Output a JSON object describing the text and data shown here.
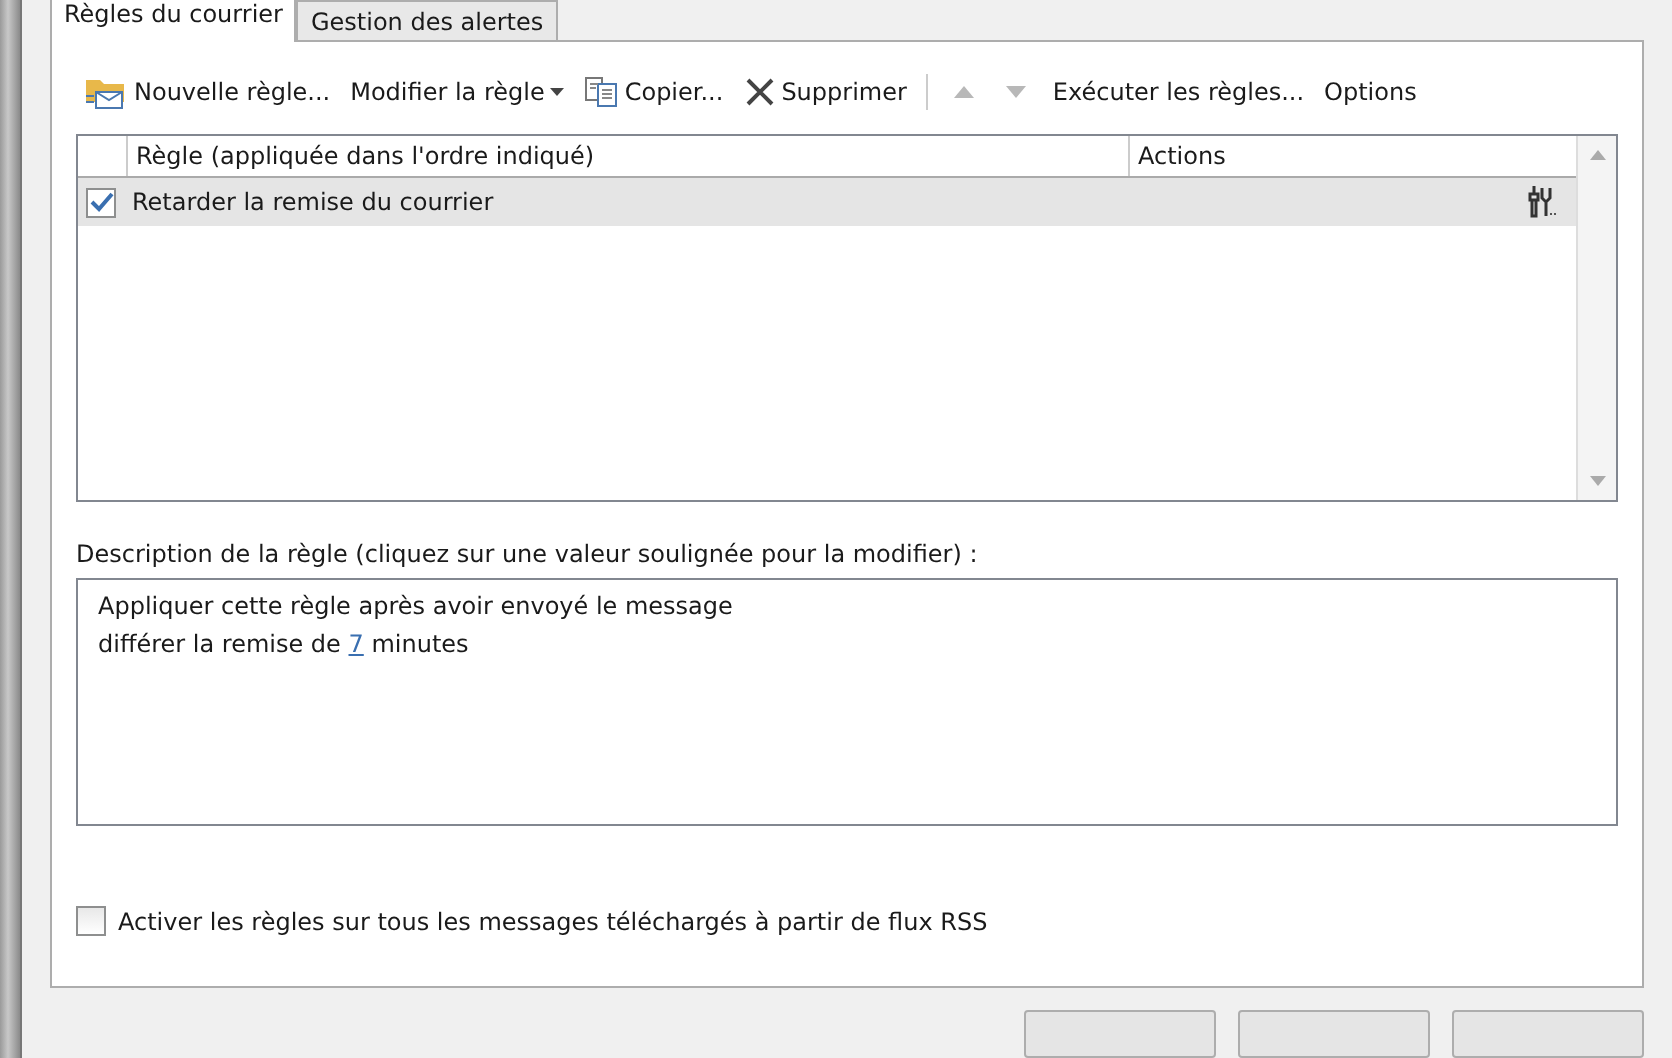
{
  "tabs": [
    {
      "label": "Règles du courrier",
      "selected": true
    },
    {
      "label": "Gestion des alertes",
      "selected": false
    }
  ],
  "toolbar": [
    {
      "kind": "new",
      "label": "Nouvelle règle...",
      "disabled": false
    },
    {
      "kind": "menu",
      "label": "Modifier la règle",
      "disabled": false
    },
    {
      "kind": "copy",
      "label": "Copier...",
      "disabled": false
    },
    {
      "kind": "delete",
      "label": "Supprimer",
      "disabled": false
    },
    {
      "kind": "up",
      "disabled": true
    },
    {
      "kind": "down",
      "disabled": true
    },
    {
      "kind": "text",
      "label": "Exécuter les règles...",
      "disabled": false
    },
    {
      "kind": "text",
      "label": "Options",
      "disabled": false
    }
  ],
  "rules_table": {
    "columns": [
      "Règle (appliquée dans l'ordre indiqué)",
      "Actions"
    ],
    "rows": [
      {
        "name": "Retarder la remise du courrier",
        "checked": true,
        "selected": true
      }
    ]
  },
  "description": {
    "label": "Description de la règle (cliquez sur une valeur soulignée pour la modifier) :",
    "lines": [
      {
        "before": "Appliquer cette règle après avoir envoyé le message"
      },
      {
        "before": "différer la remise de ",
        "link": "7",
        "after": " minutes"
      }
    ]
  },
  "rss_option": {
    "label": "Activer les règles sur tous les messages téléchargés à partir de flux RSS",
    "checked": false
  }
}
